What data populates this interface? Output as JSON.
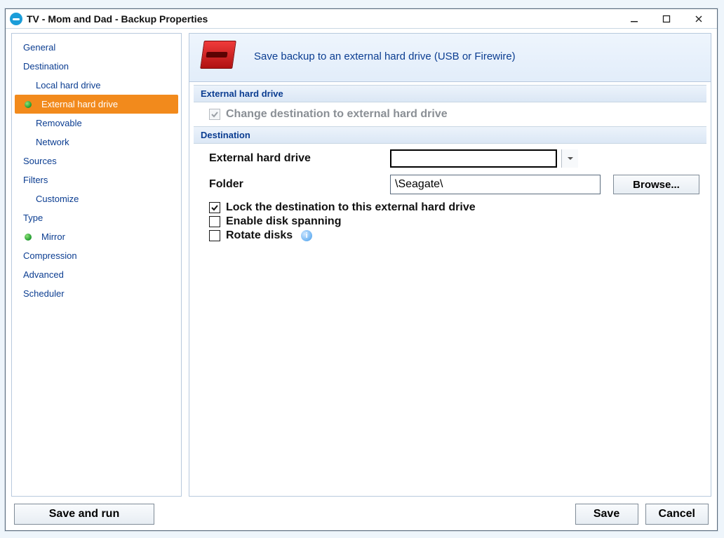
{
  "window": {
    "title": "TV - Mom and Dad - Backup Properties"
  },
  "sidebar": {
    "items": [
      {
        "label": "General"
      },
      {
        "label": "Destination"
      },
      {
        "label": "Local hard drive"
      },
      {
        "label": "External hard drive"
      },
      {
        "label": "Removable"
      },
      {
        "label": "Network"
      },
      {
        "label": "Sources"
      },
      {
        "label": "Filters"
      },
      {
        "label": "Customize"
      },
      {
        "label": "Type"
      },
      {
        "label": "Mirror"
      },
      {
        "label": "Compression"
      },
      {
        "label": "Advanced"
      },
      {
        "label": "Scheduler"
      }
    ]
  },
  "banner": {
    "message": "Save backup to an external hard drive (USB or Firewire)"
  },
  "sections": {
    "external_header": "External hard drive",
    "change_dest_label": "Change destination to external hard drive",
    "destination_header": "Destination"
  },
  "form": {
    "drive_label": "External hard drive",
    "drive_value": "",
    "folder_label": "Folder",
    "folder_value": "\\Seagate\\",
    "browse_label": "Browse...",
    "lock_label": "Lock the destination to this external hard drive",
    "span_label": "Enable disk spanning",
    "rotate_label": "Rotate disks"
  },
  "footer": {
    "save_run": "Save and run",
    "save": "Save",
    "cancel": "Cancel"
  }
}
